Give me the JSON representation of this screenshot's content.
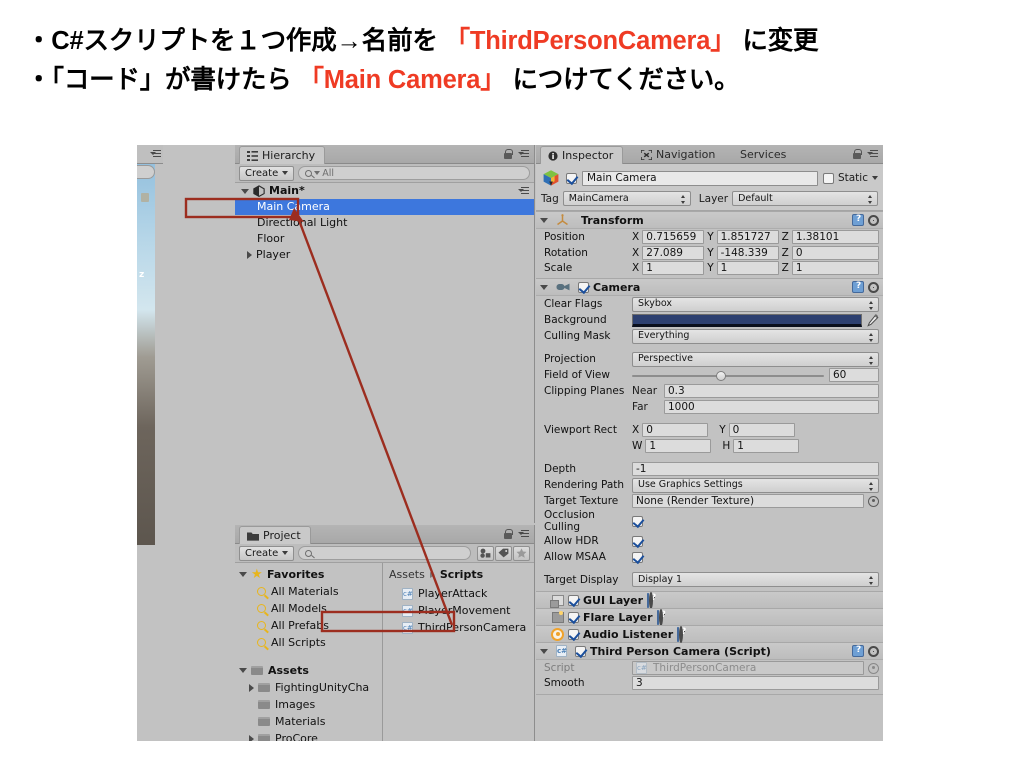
{
  "slide": {
    "line1_a": "・C#スクリプトを１つ作成→名前を ",
    "line1_hl": "「ThirdPersonCamera」",
    "line1_b": " に変更",
    "line2_a": "・「コード」が書けたら ",
    "line2_hl": "「Main Camera」",
    "line2_b": " につけてください。",
    "highlight_color": "#ef3b24"
  },
  "scene_sliver": {
    "axis_label": "z"
  },
  "hierarchy": {
    "tab_label": "Hierarchy",
    "tab_icon": "hierarchy-icon",
    "create_label": "Create",
    "search_placeholder": "All",
    "scene_name": "Main*",
    "items": [
      {
        "label": "Main Camera",
        "selected": true,
        "expandable": false
      },
      {
        "label": "Directional Light",
        "selected": false,
        "expandable": false
      },
      {
        "label": "Floor",
        "selected": false,
        "expandable": false
      },
      {
        "label": "Player",
        "selected": false,
        "expandable": true
      }
    ]
  },
  "project": {
    "tab_label": "Project",
    "create_label": "Create",
    "search_placeholder": "",
    "favorites_label": "Favorites",
    "favorites": [
      "All Materials",
      "All Models",
      "All Prefabs",
      "All Scripts"
    ],
    "assets_label": "Assets",
    "folders": [
      {
        "label": "FightingUnityCha",
        "expandable": true
      },
      {
        "label": "Images",
        "expandable": false
      },
      {
        "label": "Materials",
        "expandable": false
      },
      {
        "label": "ProCore",
        "expandable": true
      }
    ],
    "breadcrumb_root": "Assets",
    "breadcrumb_current": "Scripts",
    "files": [
      {
        "label": "PlayerAttack",
        "highlighted": false
      },
      {
        "label": "PlayerMovement",
        "highlighted": false
      },
      {
        "label": "ThirdPersonCamera",
        "highlighted": true
      }
    ]
  },
  "inspector": {
    "tabs": [
      {
        "label": "Inspector",
        "active": true,
        "icon": "info-icon"
      },
      {
        "label": "Navigation",
        "active": false,
        "icon": "navigation-icon"
      },
      {
        "label": "Services",
        "active": false,
        "icon": ""
      }
    ],
    "object_name": "Main Camera",
    "object_enabled": true,
    "static_label": "Static",
    "static_checked": false,
    "tag_label": "Tag",
    "tag_value": "MainCamera",
    "layer_label": "Layer",
    "layer_value": "Default",
    "transform": {
      "title": "Transform",
      "rows": [
        {
          "label": "Position",
          "x": "0.715659",
          "y": "1.851727",
          "z": "1.38101"
        },
        {
          "label": "Rotation",
          "x": "27.089",
          "y": "-148.339",
          "z": "0"
        },
        {
          "label": "Scale",
          "x": "1",
          "y": "1",
          "z": "1"
        }
      ]
    },
    "camera": {
      "title": "Camera",
      "enabled": true,
      "clear_flags_label": "Clear Flags",
      "clear_flags_value": "Skybox",
      "background_label": "Background",
      "background_color": "#2d4070",
      "culling_mask_label": "Culling Mask",
      "culling_mask_value": "Everything",
      "projection_label": "Projection",
      "projection_value": "Perspective",
      "fov_label": "Field of View",
      "fov_value": "60",
      "clipping_label": "Clipping Planes",
      "near_label": "Near",
      "near_value": "0.3",
      "far_label": "Far",
      "far_value": "1000",
      "viewport_label": "Viewport Rect",
      "viewport_x": "0",
      "viewport_y": "0",
      "viewport_w": "1",
      "viewport_h": "1",
      "depth_label": "Depth",
      "depth_value": "-1",
      "rendering_path_label": "Rendering Path",
      "rendering_path_value": "Use Graphics Settings",
      "target_texture_label": "Target Texture",
      "target_texture_value": "None (Render Texture)",
      "occlusion_label": "Occlusion Culling",
      "occlusion_checked": true,
      "hdr_label": "Allow HDR",
      "hdr_checked": true,
      "msaa_label": "Allow MSAA",
      "msaa_checked": true,
      "target_display_label": "Target Display",
      "target_display_value": "Display 1"
    },
    "components": [
      {
        "title": "GUI Layer",
        "enabled": true,
        "icon": "gui-layer-icon"
      },
      {
        "title": "Flare Layer",
        "enabled": true,
        "icon": "flare-layer-icon"
      },
      {
        "title": "Audio Listener",
        "enabled": true,
        "icon": "audio-listener-icon"
      }
    ],
    "script_component": {
      "title": "Third Person Camera (Script)",
      "enabled": true,
      "script_label": "Script",
      "script_value": "ThirdPersonCamera",
      "smooth_label": "Smooth",
      "smooth_value": "3"
    }
  },
  "annotations": {
    "color": "#9c2d1f",
    "arrow_from": "ThirdPersonCamera script asset",
    "arrow_to": "Main Camera hierarchy item"
  }
}
